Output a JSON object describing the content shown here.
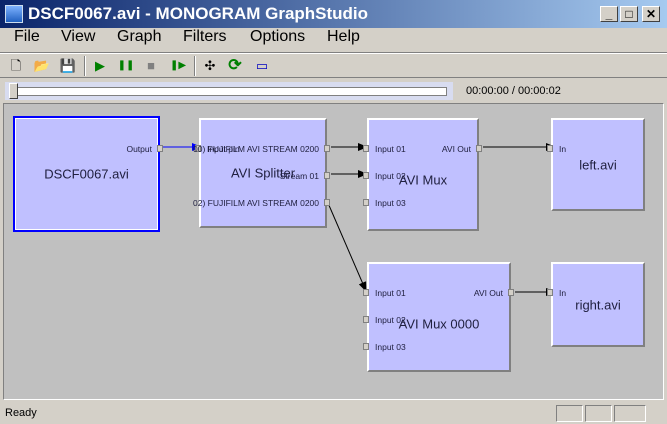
{
  "window": {
    "title": "DSCF0067.avi - MONOGRAM GraphStudio",
    "min": "_",
    "max": "□",
    "close": "✕"
  },
  "menu": [
    "File",
    "View",
    "Graph",
    "Filters",
    "Options",
    "Help"
  ],
  "toolbar": {
    "icons": [
      "new-icon",
      "open-icon",
      "save-icon",
      "play-icon",
      "pause-icon",
      "stop-icon",
      "step-icon",
      "arrange-icon",
      "refresh-icon",
      "seek-icon"
    ],
    "glyphs": [
      "🗋",
      "📂",
      "💾",
      "▶",
      "❚❚",
      "■",
      "❚▶",
      "✣",
      "⟳",
      "▭"
    ]
  },
  "seek": {
    "time": "00:00:00 / 00:00:02",
    "position": 0
  },
  "filters": {
    "source": {
      "name": "DSCF0067.avi",
      "out": "Output"
    },
    "splitter": {
      "name": "AVI Splitter",
      "in": "Input pin",
      "out": [
        "00) FUJIFILM AVI STREAM 0200",
        "Stream 01",
        "02) FUJIFILM AVI STREAM 0200"
      ]
    },
    "mux1": {
      "name": "AVI Mux",
      "in": [
        "Input 01",
        "Input 02",
        "Input 03"
      ],
      "out": "AVI Out"
    },
    "left": {
      "name": "left.avi",
      "in": "In"
    },
    "mux2": {
      "name": "AVI Mux 0000",
      "in": [
        "Input 01",
        "Input 02",
        "Input 03"
      ],
      "out": "AVI Out"
    },
    "right": {
      "name": "right.avi",
      "in": "In"
    }
  },
  "status": {
    "text": "Ready"
  }
}
